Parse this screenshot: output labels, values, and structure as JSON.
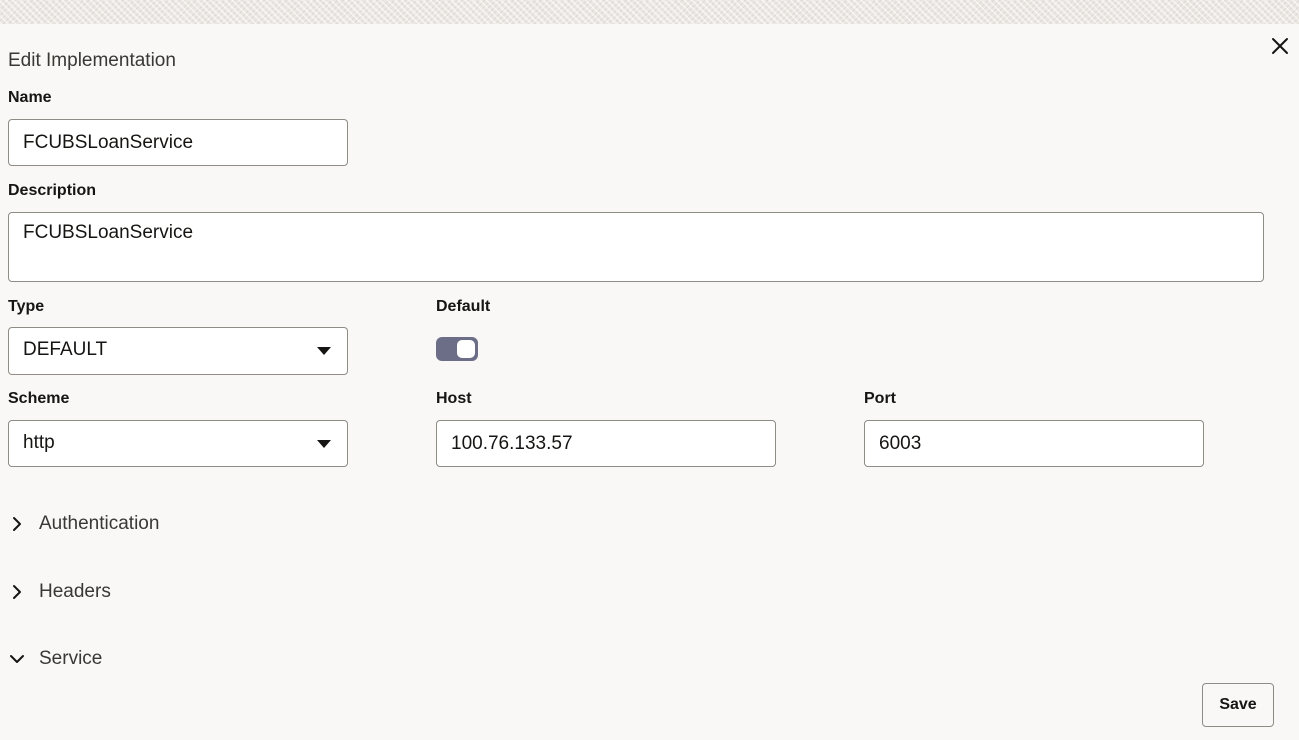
{
  "dialog": {
    "title": "Edit Implementation",
    "close_icon": "close-icon"
  },
  "form": {
    "name": {
      "label": "Name",
      "value": "FCUBSLoanService"
    },
    "description": {
      "label": "Description",
      "value": "FCUBSLoanService"
    },
    "type": {
      "label": "Type",
      "value": "DEFAULT"
    },
    "default": {
      "label": "Default",
      "checked": true
    },
    "scheme": {
      "label": "Scheme",
      "value": "http"
    },
    "host": {
      "label": "Host",
      "value": "100.76.133.57"
    },
    "port": {
      "label": "Port",
      "value": "6003"
    }
  },
  "sections": [
    {
      "label": "Authentication",
      "expanded": false
    },
    {
      "label": "Headers",
      "expanded": false
    },
    {
      "label": "Service",
      "expanded": true
    }
  ],
  "footer": {
    "save_label": "Save"
  },
  "colors": {
    "background": "#f9f8f6",
    "toggle_on": "#6b6e86",
    "border": "#8f8b85"
  }
}
